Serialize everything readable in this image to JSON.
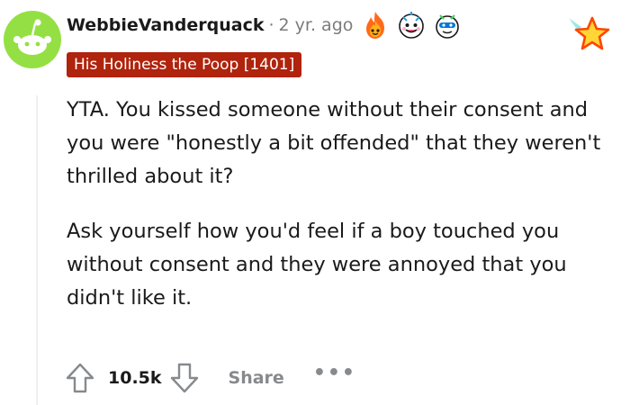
{
  "comment": {
    "author": "WebbieVanderquack",
    "separator": "·",
    "age": "2 yr. ago",
    "flair": "His Holiness the Poop [1401]",
    "awards": [
      "fire-award-icon",
      "wholesome-award-icon",
      "helpful-award-icon",
      "star-award-icon"
    ],
    "paragraphs": [
      "YTA. You kissed someone without their consent and you were \"honestly a bit offended\" that they weren't thrilled about it?",
      "Ask yourself how you'd feel if a boy touched you without consent and they were annoyed that you didn't like it."
    ],
    "score": "10.5k",
    "share_label": "Share",
    "more_label": "•••"
  },
  "colors": {
    "avatar_bg": "#94e044",
    "flair_bg": "#b0230c",
    "muted": "#878a8c",
    "text": "#1a1a1b"
  }
}
